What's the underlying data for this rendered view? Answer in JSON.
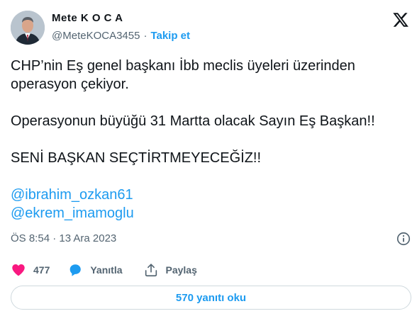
{
  "author": {
    "display_name": "Mete K O C A",
    "handle": "@MeteKOCA3455",
    "separator": "·",
    "follow_label": "Takip et"
  },
  "tweet": {
    "paragraphs": [
      "CHP’nin Eş genel başkanı İbb meclis üyeleri üzerinden operasyon çekiyor.",
      "Operasyonun büyüğü 31 Martta olacak Sayın Eş Başkan!!",
      "SENİ BAŞKAN SEÇTİRTMEYECEĞİZ!!"
    ],
    "mentions": [
      "@ibrahim_ozkan61",
      "@ekrem_imamoglu"
    ]
  },
  "meta": {
    "timestamp": "ÖS 8:54 · 13 Ara 2023"
  },
  "actions": {
    "like_count": "477",
    "reply_label": "Yanıtla",
    "share_label": "Paylaş"
  },
  "replies": {
    "read_label": "570 yanıtı oku"
  },
  "colors": {
    "accent": "#1d9bf0",
    "like": "#f91880",
    "text": "#0f1419",
    "secondary": "#536471"
  },
  "icons": [
    "x-logo-icon",
    "info-icon",
    "heart-icon",
    "reply-bubble-icon",
    "share-icon"
  ]
}
